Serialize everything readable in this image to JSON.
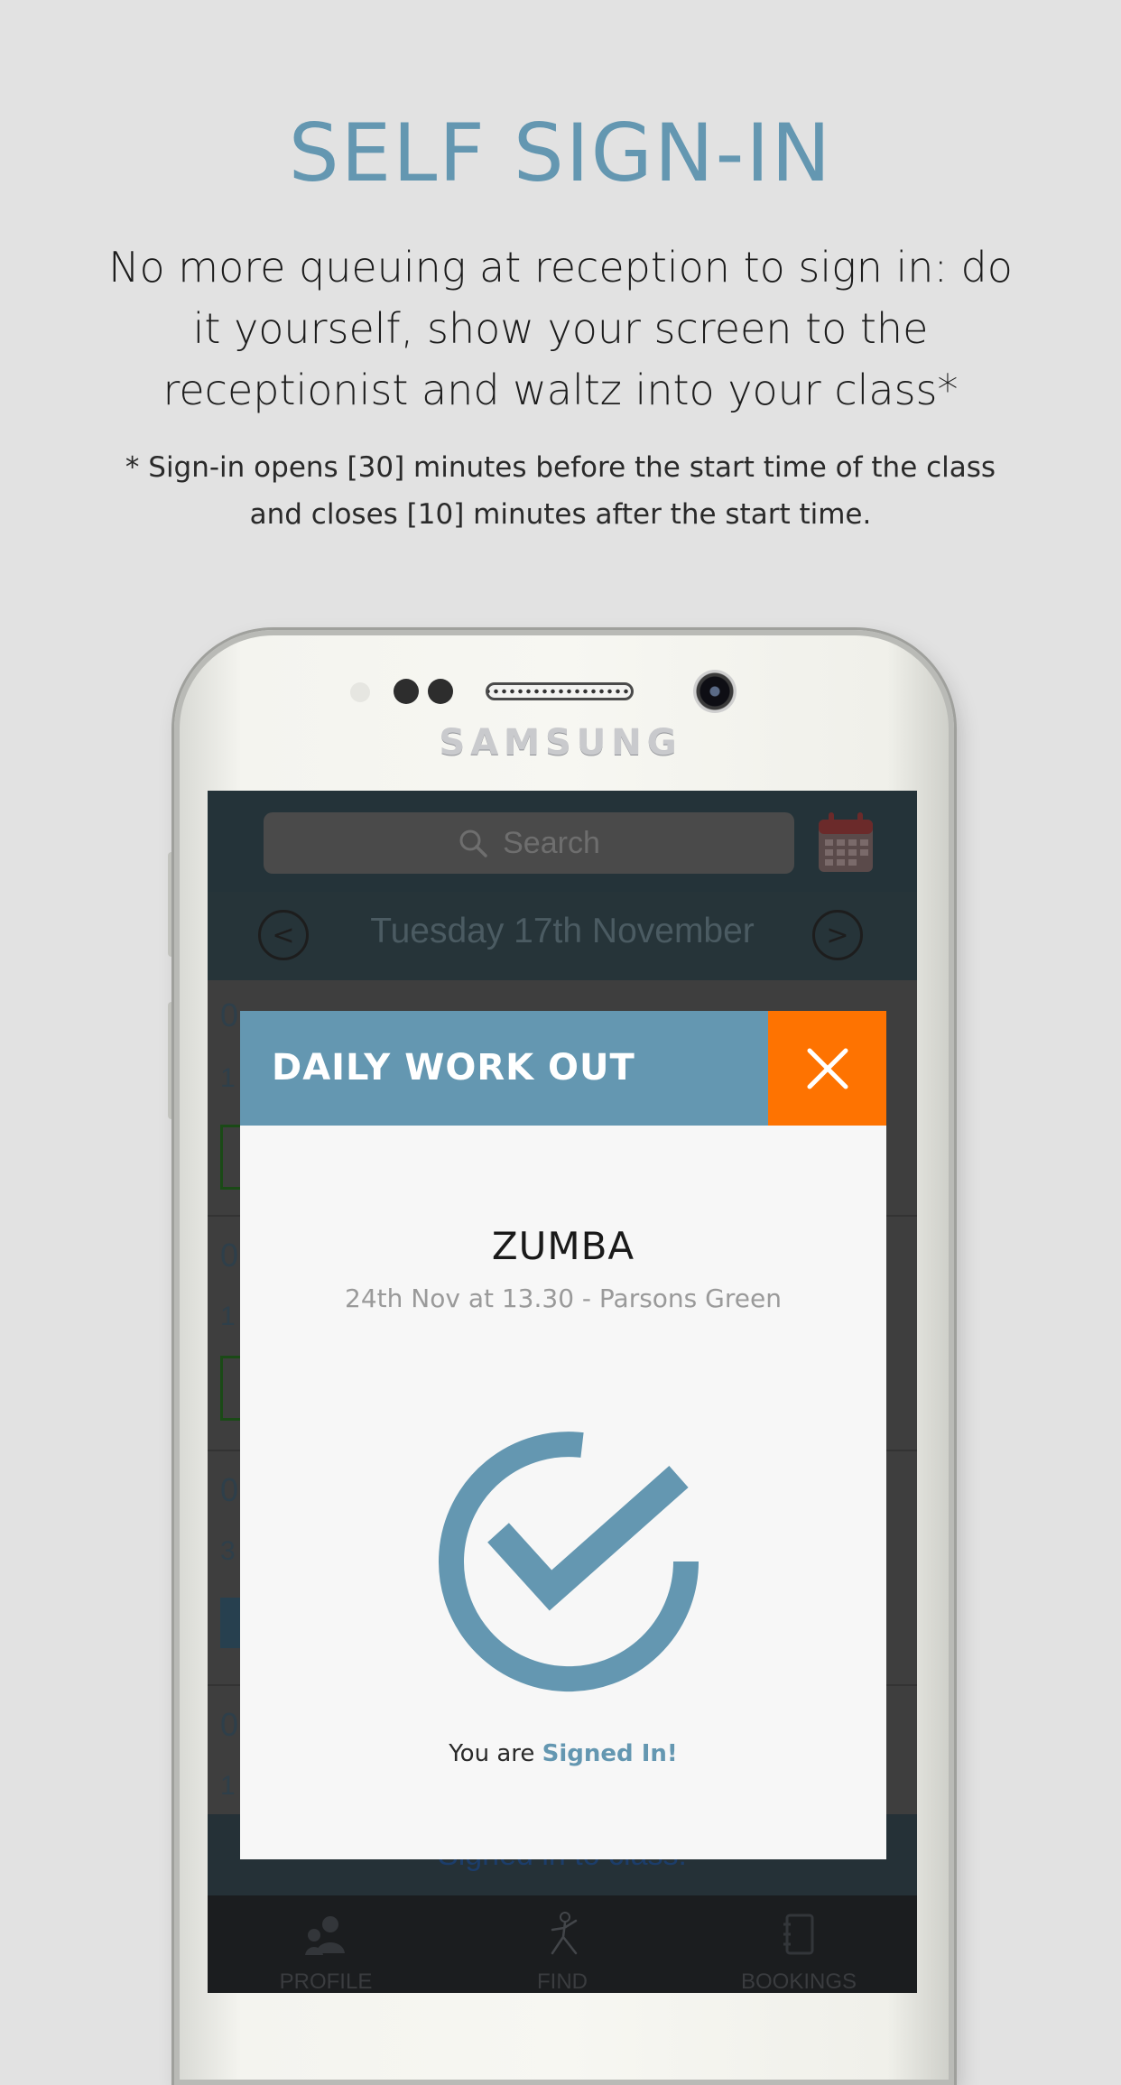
{
  "promo": {
    "title": "SELF SIGN-IN",
    "body": "No more queuing at reception to sign in: do it yourself, show your screen to the receptionist and waltz into your class*",
    "note": "* Sign-in opens [30] minutes before the start time of the class and closes [10] minutes after the start time."
  },
  "device": {
    "brand": "SAMSUNG"
  },
  "app": {
    "search": {
      "placeholder": "Search",
      "icon": "search-icon"
    },
    "calendar_icon": "calendar-icon",
    "date_nav": {
      "date": "Tuesday 17th November",
      "prev": "<",
      "next": ">"
    },
    "rows": [
      {
        "time": "0",
        "sub": "1"
      },
      {
        "time": "0",
        "sub": "1"
      },
      {
        "time": "0",
        "sub": "3"
      },
      {
        "time": "0",
        "sub": "1"
      }
    ],
    "bottom_banner": "Signed in to class!",
    "tabs": [
      {
        "label": "PROFILE",
        "icon": "profile-icon"
      },
      {
        "label": "FIND",
        "icon": "yoga-pose-icon"
      },
      {
        "label": "BOOKINGS",
        "icon": "notebook-icon"
      }
    ]
  },
  "modal": {
    "title": "DAILY WORK OUT",
    "close_icon": "close-icon",
    "class_name": "ZUMBA",
    "class_detail": "24th Nov at 13.30 - Parsons Green",
    "status_prefix": "You are ",
    "status_highlight": "Signed In!",
    "check_icon": "checkmark-circle-icon"
  },
  "colors": {
    "accent": "#6497b1",
    "close": "#fe7301",
    "background": "#e2e2e2"
  }
}
